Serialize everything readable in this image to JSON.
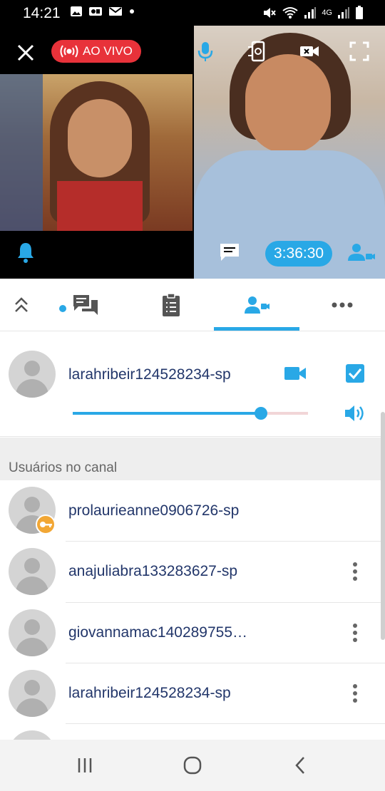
{
  "status_bar": {
    "time": "14:21",
    "network_label": "4G",
    "left_icons": [
      "image-icon",
      "video-notification-icon",
      "mail-icon",
      "dot-icon"
    ],
    "right_icons": [
      "mute-icon",
      "wifi-icon",
      "signal-icon",
      "battery-icon"
    ]
  },
  "live": {
    "label": "AO VIVO"
  },
  "call": {
    "timer": "3:36:30"
  },
  "tabs": [
    {
      "id": "expand",
      "icon": "double-chevron-up-icon"
    },
    {
      "id": "chat",
      "icon": "chat-icon"
    },
    {
      "id": "clipboard",
      "icon": "clipboard-icon"
    },
    {
      "id": "users",
      "icon": "user-camera-icon",
      "active": true
    },
    {
      "id": "more",
      "icon": "more-horizontal-icon"
    }
  ],
  "selected_user": {
    "name": "larahribeir124528234-sp",
    "volume": 0.8
  },
  "section": {
    "title": "Usuários no canal"
  },
  "users": [
    {
      "name": "prolaurieanne0906726-sp",
      "is_owner": true
    },
    {
      "name": "anajuliabra133283627-sp"
    },
    {
      "name": "giovannamac140289755…"
    },
    {
      "name": "larahribeir124528234-sp"
    }
  ],
  "colors": {
    "accent": "#29a8e6",
    "live_red": "#e8323a",
    "username_text": "#22366a",
    "owner_key": "#f2a735"
  }
}
